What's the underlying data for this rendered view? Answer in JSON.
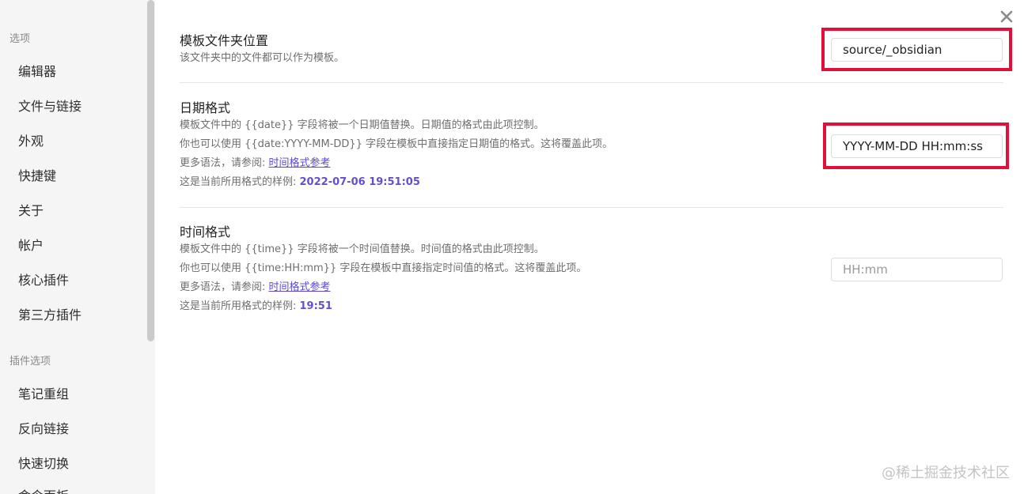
{
  "sidebar": {
    "section_options": "选项",
    "options_items": [
      "编辑器",
      "文件与链接",
      "外观",
      "快捷键",
      "关于",
      "帐户",
      "核心插件",
      "第三方插件"
    ],
    "section_plugin_options": "插件选项",
    "plugin_items": [
      "笔记重组",
      "反向链接",
      "快速切换",
      "命令面板"
    ]
  },
  "close_icon": "close-icon",
  "settings": {
    "folder": {
      "title": "模板文件夹位置",
      "desc": "该文件夹中的文件都可以作为模板。",
      "value": "source/_obsidian"
    },
    "date": {
      "title": "日期格式",
      "desc1": "模板文件中的 {{date}} 字段将被一个日期值替换。日期值的格式由此项控制。",
      "desc2": "你也可以使用 {{date:YYYY-MM-DD}} 字段在模板中直接指定日期值的格式。这将覆盖此项。",
      "more_prefix": "更多语法，请参阅: ",
      "more_link": "时间格式参考",
      "sample_prefix": "这是当前所用格式的样例: ",
      "sample": "2022-07-06 19:51:05",
      "value": "YYYY-MM-DD HH:mm:ss"
    },
    "time": {
      "title": "时间格式",
      "desc1": "模板文件中的 {{time}} 字段将被一个时间值替换。时间值的格式由此项控制。",
      "desc2": "你也可以使用 {{time:HH:mm}} 字段在模板中直接指定时间值的格式。这将覆盖此项。",
      "more_prefix": "更多语法，请参阅: ",
      "more_link": "时间格式参考",
      "sample_prefix": "这是当前所用格式的样例: ",
      "sample": "19:51",
      "placeholder": "HH:mm"
    }
  },
  "watermark": "@稀土掘金技术社区",
  "colors": {
    "highlight": "#e0103a",
    "link": "#5b4bd6",
    "sample": "#6450c8"
  }
}
